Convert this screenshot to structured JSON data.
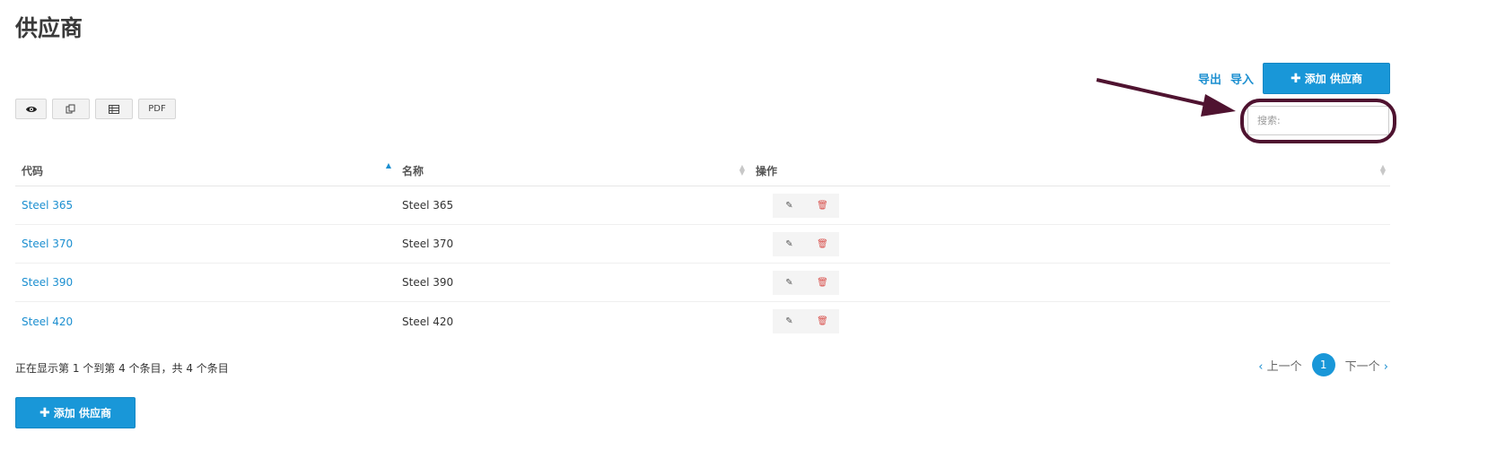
{
  "page": {
    "title": "供应商"
  },
  "toolbar": {
    "export_label": "导出",
    "import_label": "导入",
    "add_label": "添加 供应商"
  },
  "export_buttons": {
    "view_icon": "eye-icon",
    "copy_icon": "copy-icon",
    "table_icon": "table-icon",
    "pdf_label": "PDF"
  },
  "search": {
    "placeholder": "搜索:"
  },
  "table": {
    "headers": {
      "code": "代码",
      "name": "名称",
      "actions": "操作"
    },
    "rows": [
      {
        "code": "Steel 365",
        "name": "Steel 365"
      },
      {
        "code": "Steel 370",
        "name": "Steel 370"
      },
      {
        "code": "Steel 390",
        "name": "Steel 390"
      },
      {
        "code": "Steel 420",
        "name": "Steel 420"
      }
    ]
  },
  "info_text": "正在显示第 1 个到第 4 个条目，共 4 个条目",
  "pagination": {
    "prev_label": "上一个",
    "current_page": "1",
    "next_label": "下一个"
  },
  "colors": {
    "accent": "#1997d8",
    "link": "#1c8fd0",
    "annotation": "#4f1330",
    "delete": "#d9534f"
  }
}
